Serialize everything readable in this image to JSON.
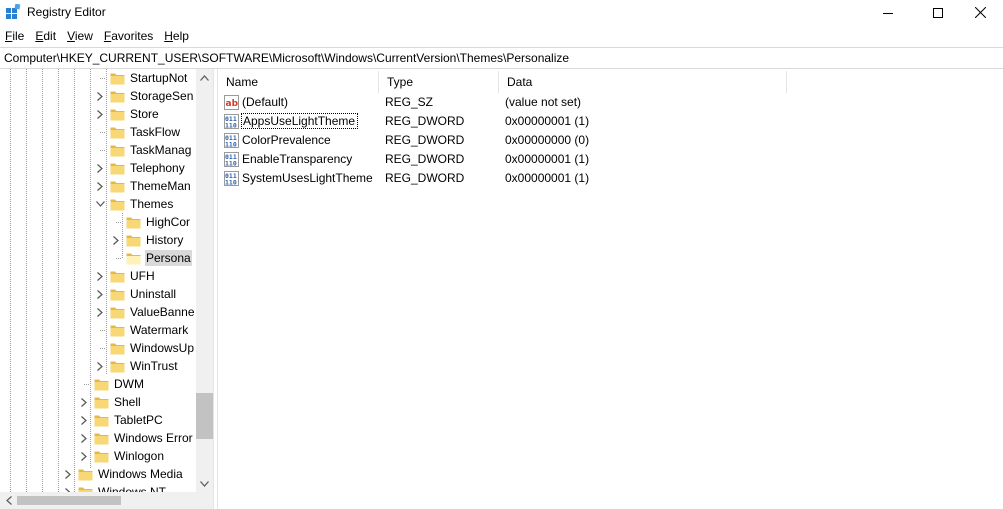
{
  "window": {
    "title": "Registry Editor",
    "controls": {
      "minimize": "minimize",
      "maximize": "maximize",
      "close": "close"
    }
  },
  "menu": [
    {
      "label_u": "F",
      "label_rest": "ile"
    },
    {
      "label_u": "E",
      "label_rest": "dit"
    },
    {
      "label_u": "V",
      "label_rest": "iew"
    },
    {
      "label_u": "F",
      "label_rest": "avorites",
      "label_full": "Favorites"
    },
    {
      "label_u": "H",
      "label_rest": "elp"
    }
  ],
  "address": "Computer\\HKEY_CURRENT_USER\\SOFTWARE\\Microsoft\\Windows\\CurrentVersion\\Themes\\Personalize",
  "tree": {
    "nodes": [
      {
        "label": "StartupNot",
        "expandable": false
      },
      {
        "label": "StorageSen",
        "expandable": true
      },
      {
        "label": "Store",
        "expandable": true
      },
      {
        "label": "TaskFlow",
        "expandable": false
      },
      {
        "label": "TaskManag",
        "expandable": false
      },
      {
        "label": "Telephony",
        "expandable": true
      },
      {
        "label": "ThemeMan",
        "expandable": true
      },
      {
        "label": "Themes",
        "expandable": true,
        "expanded": true
      },
      {
        "label": "HighCor",
        "expandable": false
      },
      {
        "label": "History",
        "expandable": true
      },
      {
        "label": "Persona",
        "expandable": false,
        "selected": true
      },
      {
        "label": "UFH",
        "expandable": true
      },
      {
        "label": "Uninstall",
        "expandable": true
      },
      {
        "label": "ValueBanne",
        "expandable": true
      },
      {
        "label": "Watermark",
        "expandable": false
      },
      {
        "label": "WindowsUp",
        "expandable": false
      },
      {
        "label": "WinTrust",
        "expandable": true
      },
      {
        "label": "DWM",
        "expandable": false
      },
      {
        "label": "Shell",
        "expandable": true
      },
      {
        "label": "TabletPC",
        "expandable": true
      },
      {
        "label": "Windows Error",
        "expandable": true
      },
      {
        "label": "Winlogon",
        "expandable": true
      },
      {
        "label": "Windows Media",
        "expandable": true
      },
      {
        "label": "Windows NT",
        "expandable": true
      }
    ]
  },
  "list": {
    "columns": [
      "Name",
      "Type",
      "Data"
    ],
    "rows": [
      {
        "name": "(Default)",
        "type": "REG_SZ",
        "data": "(value not set)",
        "icon": "string-value-icon"
      },
      {
        "name": "AppsUseLightTheme",
        "type": "REG_DWORD",
        "data": "0x00000001 (1)",
        "icon": "binary-value-icon"
      },
      {
        "name": "ColorPrevalence",
        "type": "REG_DWORD",
        "data": "0x00000000 (0)",
        "icon": "binary-value-icon"
      },
      {
        "name": "EnableTransparency",
        "type": "REG_DWORD",
        "data": "0x00000001 (1)",
        "icon": "binary-value-icon"
      },
      {
        "name": "SystemUsesLightTheme",
        "type": "REG_DWORD",
        "data": "0x00000001 (1)",
        "icon": "binary-value-icon"
      }
    ]
  },
  "colors": {
    "folder": "#f8d775",
    "folder_dark": "#e6b84a",
    "selection": "#d9d9d9",
    "string_icon": "#d23a2c",
    "binary_icon": "#2b5fa8"
  }
}
